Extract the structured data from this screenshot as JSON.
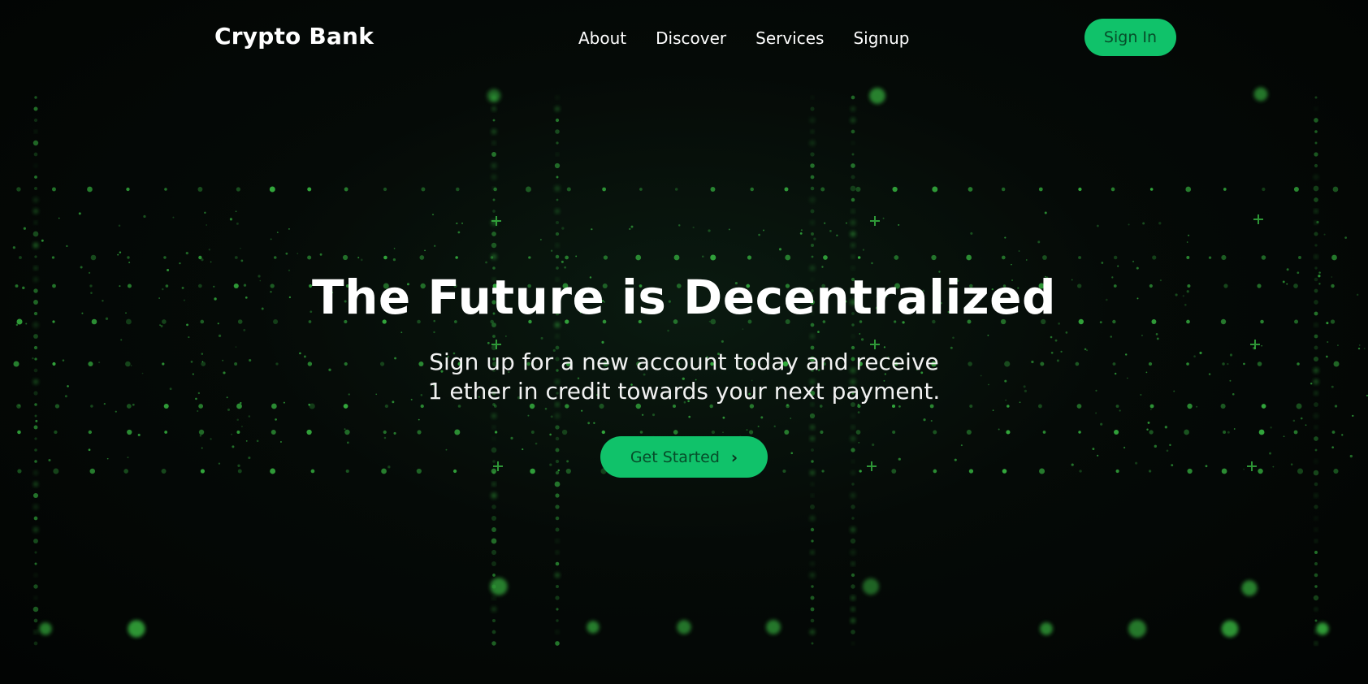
{
  "brand": {
    "name": "Crypto Bank"
  },
  "nav": {
    "links": [
      "About",
      "Discover",
      "Services",
      "Signup"
    ],
    "signin_label": "Sign In"
  },
  "hero": {
    "title": "The Future is Decentralized",
    "subtitle": "Sign up for a new account today and receive 1 ether in credit towards your next payment.",
    "cta_label": "Get Started",
    "cta_icon": "chevron-right-icon"
  },
  "colors": {
    "accent": "#10c26a",
    "accent_text": "#064d2a",
    "background": "#030605",
    "glow": "#3fd14a"
  }
}
